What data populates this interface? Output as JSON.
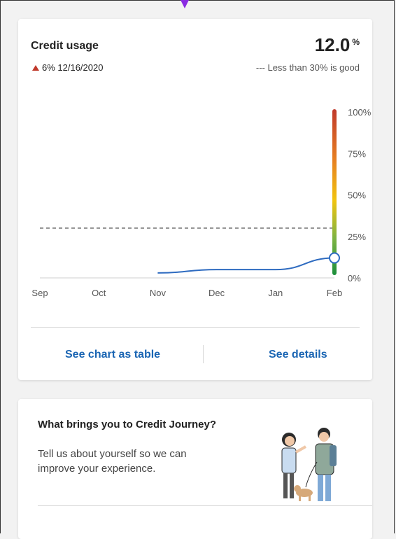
{
  "credit_usage": {
    "title": "Credit usage",
    "value": "12.0",
    "unit": "%",
    "delta_text": "6% 12/16/2020",
    "legend_text": "--- Less than 30% is good",
    "actions": {
      "table_label": "See chart as table",
      "details_label": "See details"
    }
  },
  "chart_data": {
    "type": "line",
    "x": [
      "Sep",
      "Oct",
      "Nov",
      "Dec",
      "Jan",
      "Feb"
    ],
    "series": [
      {
        "values": [
          null,
          null,
          3,
          5,
          5,
          12
        ]
      }
    ],
    "ylim": [
      0,
      100
    ],
    "y_ticks": [
      "0%",
      "25%",
      "50%",
      "75%",
      "100%"
    ],
    "threshold": 30,
    "grid": false
  },
  "prompt_card": {
    "title": "What brings you to Credit Journey?",
    "body": "Tell us about yourself so we can improve your experience."
  },
  "colors": {
    "accent": "#1a65b3",
    "line": "#2e6bc0",
    "decrease": "#c0392b"
  }
}
